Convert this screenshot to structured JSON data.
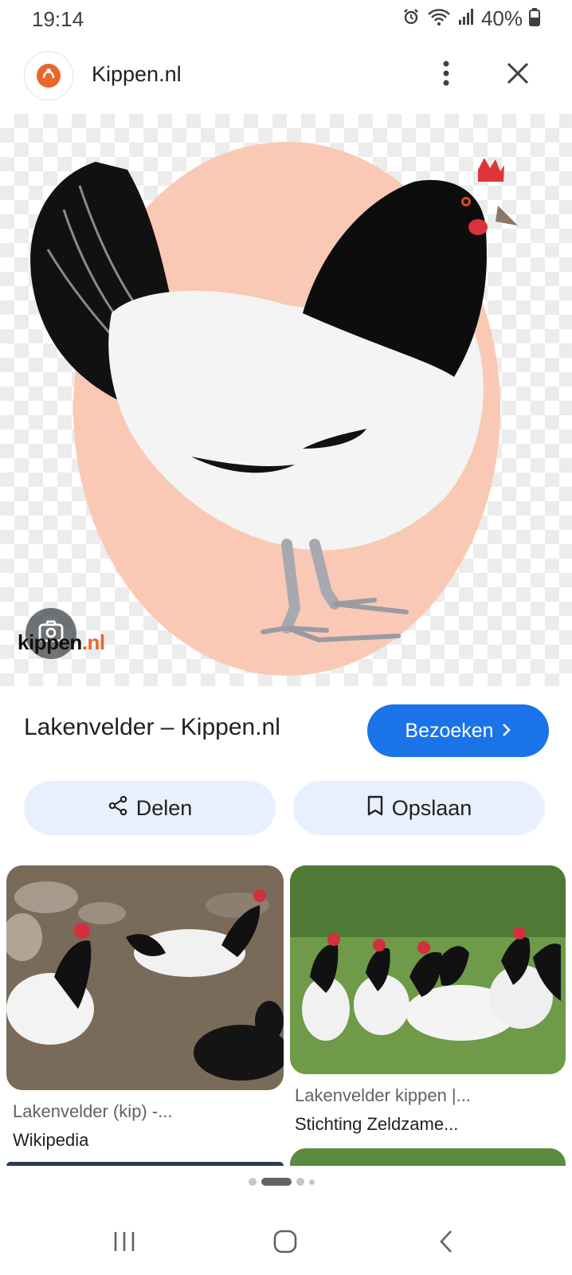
{
  "status_bar": {
    "time": "19:14",
    "battery": "40%",
    "icons": [
      "alarm-icon",
      "wifi-icon",
      "signal-icon",
      "battery-icon"
    ]
  },
  "header": {
    "site_name": "Kippen.nl",
    "logo_icon": "kippen-logo-icon",
    "more_icon": "more-vert-icon",
    "close_icon": "close-icon"
  },
  "main_image": {
    "watermark_brand": "kippen",
    "watermark_tld": ".nl",
    "lens_icon": "google-lens-icon",
    "colors": {
      "egg": "#f9c9b6",
      "checker": "#ececec"
    }
  },
  "result": {
    "title": "Lakenvelder – Kippen.nl",
    "visit_label": "Bezoeken",
    "visit_icon": "chevron-right-icon",
    "share_label": "Delen",
    "share_icon": "share-icon",
    "save_label": "Opslaan",
    "save_icon": "bookmark-icon",
    "accent": "#1a73e8",
    "action_bg": "#e8f0fe"
  },
  "related": [
    {
      "caption": "Lakenvelder (kip) -...",
      "source": "Wikipedia"
    },
    {
      "caption": "Lakenvelder kippen |...",
      "source": "Stichting Zeldzame..."
    }
  ],
  "pager": {
    "pages": 4,
    "active_index": 1
  },
  "nav_bar": {
    "recents_icon": "recents-icon",
    "home_icon": "home-icon",
    "back_icon": "back-icon"
  }
}
